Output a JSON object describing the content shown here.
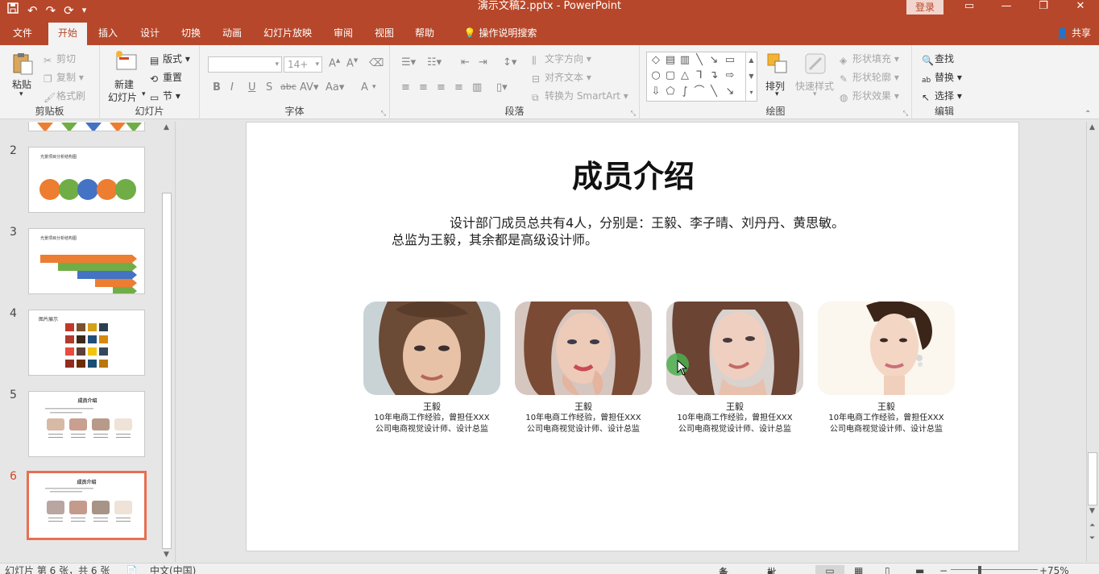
{
  "window": {
    "title": "演示文稿2.pptx  -  PowerPoint",
    "login": "登录"
  },
  "menu": {
    "tabs": [
      "文件",
      "开始",
      "插入",
      "设计",
      "切换",
      "动画",
      "幻灯片放映",
      "审阅",
      "视图",
      "帮助"
    ],
    "active": "开始",
    "search_hint": "操作说明搜索",
    "share": "共享"
  },
  "ribbon": {
    "clipboard": {
      "label": "剪贴板",
      "paste": "粘贴",
      "cut": "剪切",
      "copy": "复制",
      "format_painter": "格式刷"
    },
    "slides": {
      "label": "幻灯片",
      "new_slide_1": "新建",
      "new_slide_2": "幻灯片",
      "layout": "版式",
      "reset": "重置",
      "section": "节"
    },
    "font": {
      "label": "字体",
      "font_size": "14+",
      "clear_format": "A"
    },
    "paragraph": {
      "label": "段落",
      "text_direction": "文字方向",
      "align_text": "对齐文本",
      "smartart": "转换为 SmartArt"
    },
    "drawing": {
      "label": "绘图",
      "arrange": "排列",
      "quick_styles": "快速样式",
      "shape_fill": "形状填充",
      "shape_outline": "形状轮廓",
      "shape_effects": "形状效果"
    },
    "editing": {
      "label": "编辑",
      "find": "查找",
      "replace": "替换",
      "select": "选择"
    }
  },
  "slide_panel": {
    "thumbnails": [
      {
        "num": "2",
        "title": "光景项目分析结构图"
      },
      {
        "num": "3",
        "title": "光景项目分析结构图"
      },
      {
        "num": "4",
        "title": "图片展示"
      },
      {
        "num": "5",
        "title": "成员介绍"
      },
      {
        "num": "6",
        "title": "成员介绍"
      }
    ],
    "selected": "6"
  },
  "slide": {
    "title": "成员介绍",
    "body_line1": "设计部门成员总共有4人，分别是：王毅、李子晴、刘丹丹、黄思敏。",
    "body_line2": "总监为王毅，其余都是高级设计师。",
    "members": [
      {
        "name": "王毅",
        "desc1": "10年电商工作经验，曾担任XXX",
        "desc2": "公司电商视觉设计师、设计总监"
      },
      {
        "name": "王毅",
        "desc1": "10年电商工作经验，曾担任XXX",
        "desc2": "公司电商视觉设计师、设计总监"
      },
      {
        "name": "王毅",
        "desc1": "10年电商工作经验，曾担任XXX",
        "desc2": "公司电商视觉设计师、设计总监"
      },
      {
        "name": "王毅",
        "desc1": "10年电商工作经验，曾担任XXX",
        "desc2": "公司电商视觉设计师、设计总监"
      }
    ]
  },
  "status": {
    "slide_info": "幻灯片 第 6 张，共 6 张",
    "language": "中文(中国)",
    "notes": "备注",
    "comments": "批注",
    "zoom": "75%"
  },
  "colors": {
    "accent": "#b7472a",
    "selected_border": "#e86f52"
  }
}
